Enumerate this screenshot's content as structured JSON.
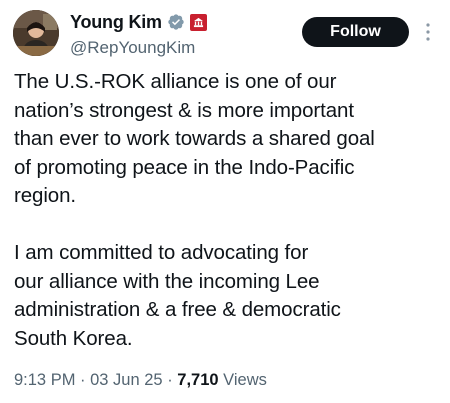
{
  "author": {
    "display_name": "Young Kim",
    "handle": "@RepYoungKim",
    "verified_icon": "verified-badge-icon",
    "affiliation_icon": "government-badge-icon"
  },
  "actions": {
    "follow_label": "Follow",
    "more_icon": "more-options-icon"
  },
  "tweet": {
    "text": "The U.S.-ROK alliance is one of our\nnation’s strongest & is more important\nthan ever to work towards a shared goal\nof promoting peace in the Indo-Pacific\nregion.\n\nI am committed to advocating for\nour alliance with the incoming Lee\nadministration & a free & democratic\nSouth Korea."
  },
  "meta": {
    "time": "9:13 PM",
    "separator": " · ",
    "date": "03 Jun 25",
    "views_count": "7,710",
    "views_label": " Views"
  },
  "colors": {
    "text_primary": "#0f1419",
    "text_secondary": "#536471",
    "verified_blue": "#1d9bf0",
    "government_red": "#c8202f",
    "follow_bg": "#0f1419"
  }
}
